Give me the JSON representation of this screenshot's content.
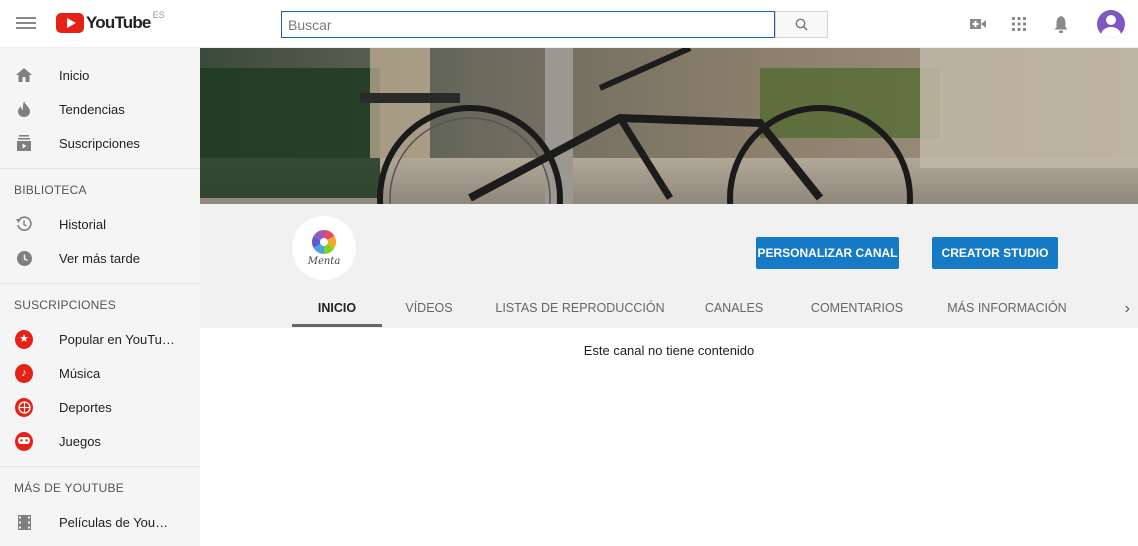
{
  "header": {
    "logo_text": "YouTube",
    "logo_region": "ES",
    "search_placeholder": "Buscar"
  },
  "sidebar": {
    "main": [
      {
        "label": "Inicio",
        "icon": "home-icon"
      },
      {
        "label": "Tendencias",
        "icon": "flame-icon"
      },
      {
        "label": "Suscripciones",
        "icon": "subscriptions-icon"
      }
    ],
    "library_heading": "BIBLIOTECA",
    "library": [
      {
        "label": "Historial",
        "icon": "history-icon"
      },
      {
        "label": "Ver más tarde",
        "icon": "clock-icon"
      }
    ],
    "subscriptions_heading": "SUSCRIPCIONES",
    "subscriptions": [
      {
        "label": "Popular en YouTu…",
        "icon": "star-icon"
      },
      {
        "label": "Música",
        "icon": "music-note-icon"
      },
      {
        "label": "Deportes",
        "icon": "ball-icon"
      },
      {
        "label": "Juegos",
        "icon": "gamepad-icon"
      }
    ],
    "more_heading": "MÁS DE YOUTUBE",
    "more": [
      {
        "label": "Películas de You…",
        "icon": "film-icon"
      }
    ]
  },
  "channel": {
    "logo_name": "Menta",
    "customize_button": "PERSONALIZAR CANAL",
    "studio_button": "CREATOR STUDIO",
    "tabs": [
      "INICIO",
      "VÍDEOS",
      "LISTAS DE REPRODUCCIÓN",
      "CANALES",
      "COMENTARIOS",
      "MÁS INFORMACIÓN"
    ],
    "active_tab": "INICIO"
  },
  "empty_message": "Este canal no tiene contenido",
  "colors": {
    "brand_red": "#e62117",
    "button_blue": "#167ac6",
    "sidebar_bg": "#f5f5f5"
  }
}
